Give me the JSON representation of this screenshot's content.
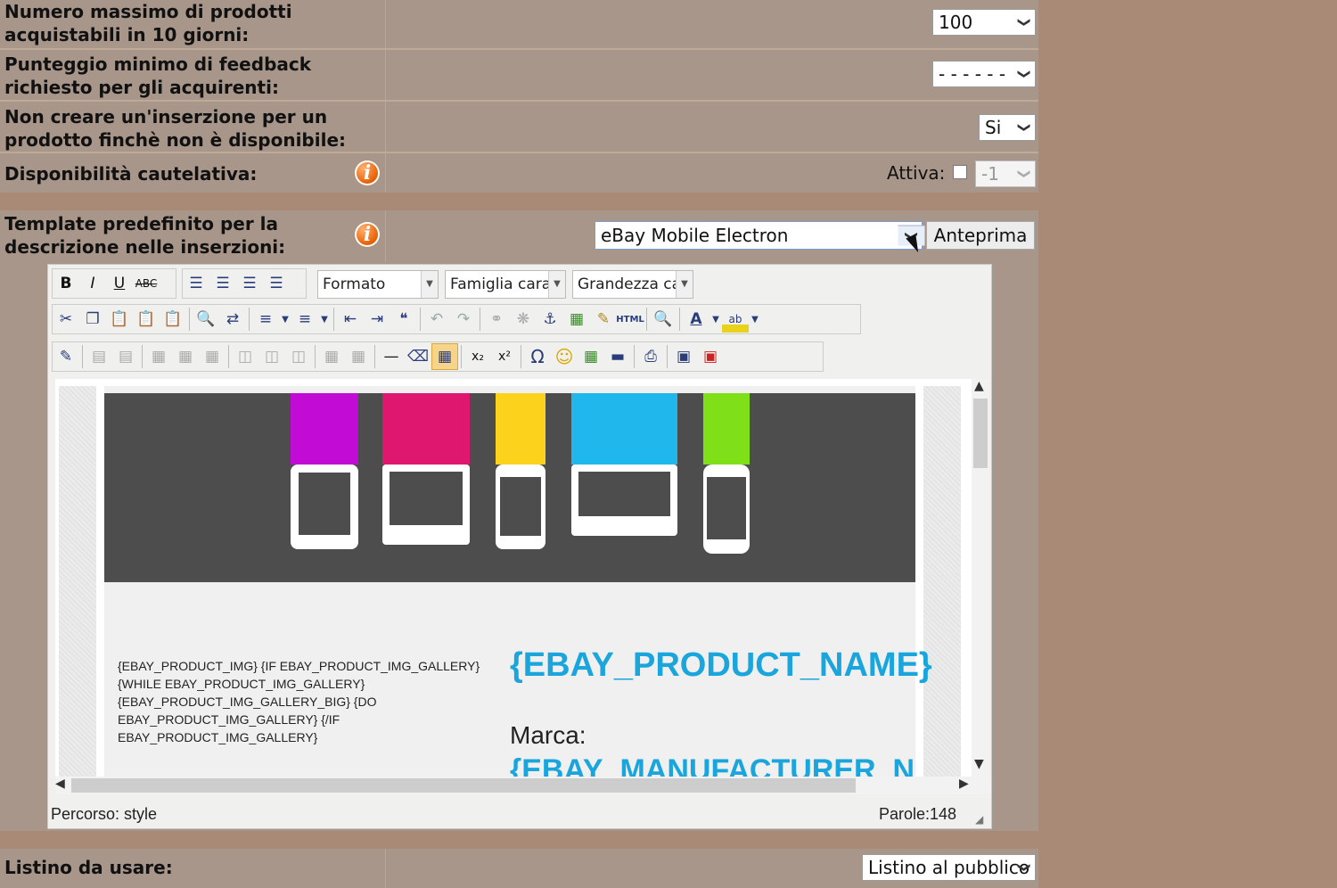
{
  "rows": {
    "max_products_label": "Numero massimo di prodotti acquistabili in 10 giorni:",
    "max_products_value": "100",
    "min_feedback_label": "Punteggio minimo di feedback richiesto per gli acquirenti:",
    "min_feedback_value": "- - - - - -",
    "no_listing_label": "Non creare un'inserzione per un prodotto finchè non è disponibile:",
    "no_listing_value": "Si",
    "safety_stock_label": "Disponibilità cautelativa:",
    "safety_active_label": "Attiva:",
    "safety_value": "-1",
    "template_label": "Template predefinito per la descrizione nelle inserzioni:",
    "template_value": "eBay Mobile Electron",
    "preview_button": "Anteprima",
    "pricelist_label": "Listino da usare:",
    "pricelist_value": "Listino al pubblico"
  },
  "editor": {
    "format_dropdown": "Formato",
    "font_family_dropdown": "Famiglia caratt",
    "font_size_dropdown": "Grandezza cara",
    "gallery_placeholder": "{EBAY_PRODUCT_IMG} {IF EBAY_PRODUCT_IMG_GALLERY} {WHILE EBAY_PRODUCT_IMG_GALLERY} {EBAY_PRODUCT_IMG_GALLERY_BIG} {DO EBAY_PRODUCT_IMG_GALLERY} {/IF EBAY_PRODUCT_IMG_GALLERY}",
    "product_name": "{EBAY_PRODUCT_NAME}",
    "brand_label": "Marca:",
    "manufacturer": "{EBAY_MANUFACTURER_N",
    "path_label": "Percorso: style",
    "word_count": "Parole:148",
    "banner_colors": [
      "#c20bd4",
      "#e0176f",
      "#fdd21c",
      "#20b8ec",
      "#7fe01a"
    ],
    "accent_color": "#1aa6dc"
  }
}
